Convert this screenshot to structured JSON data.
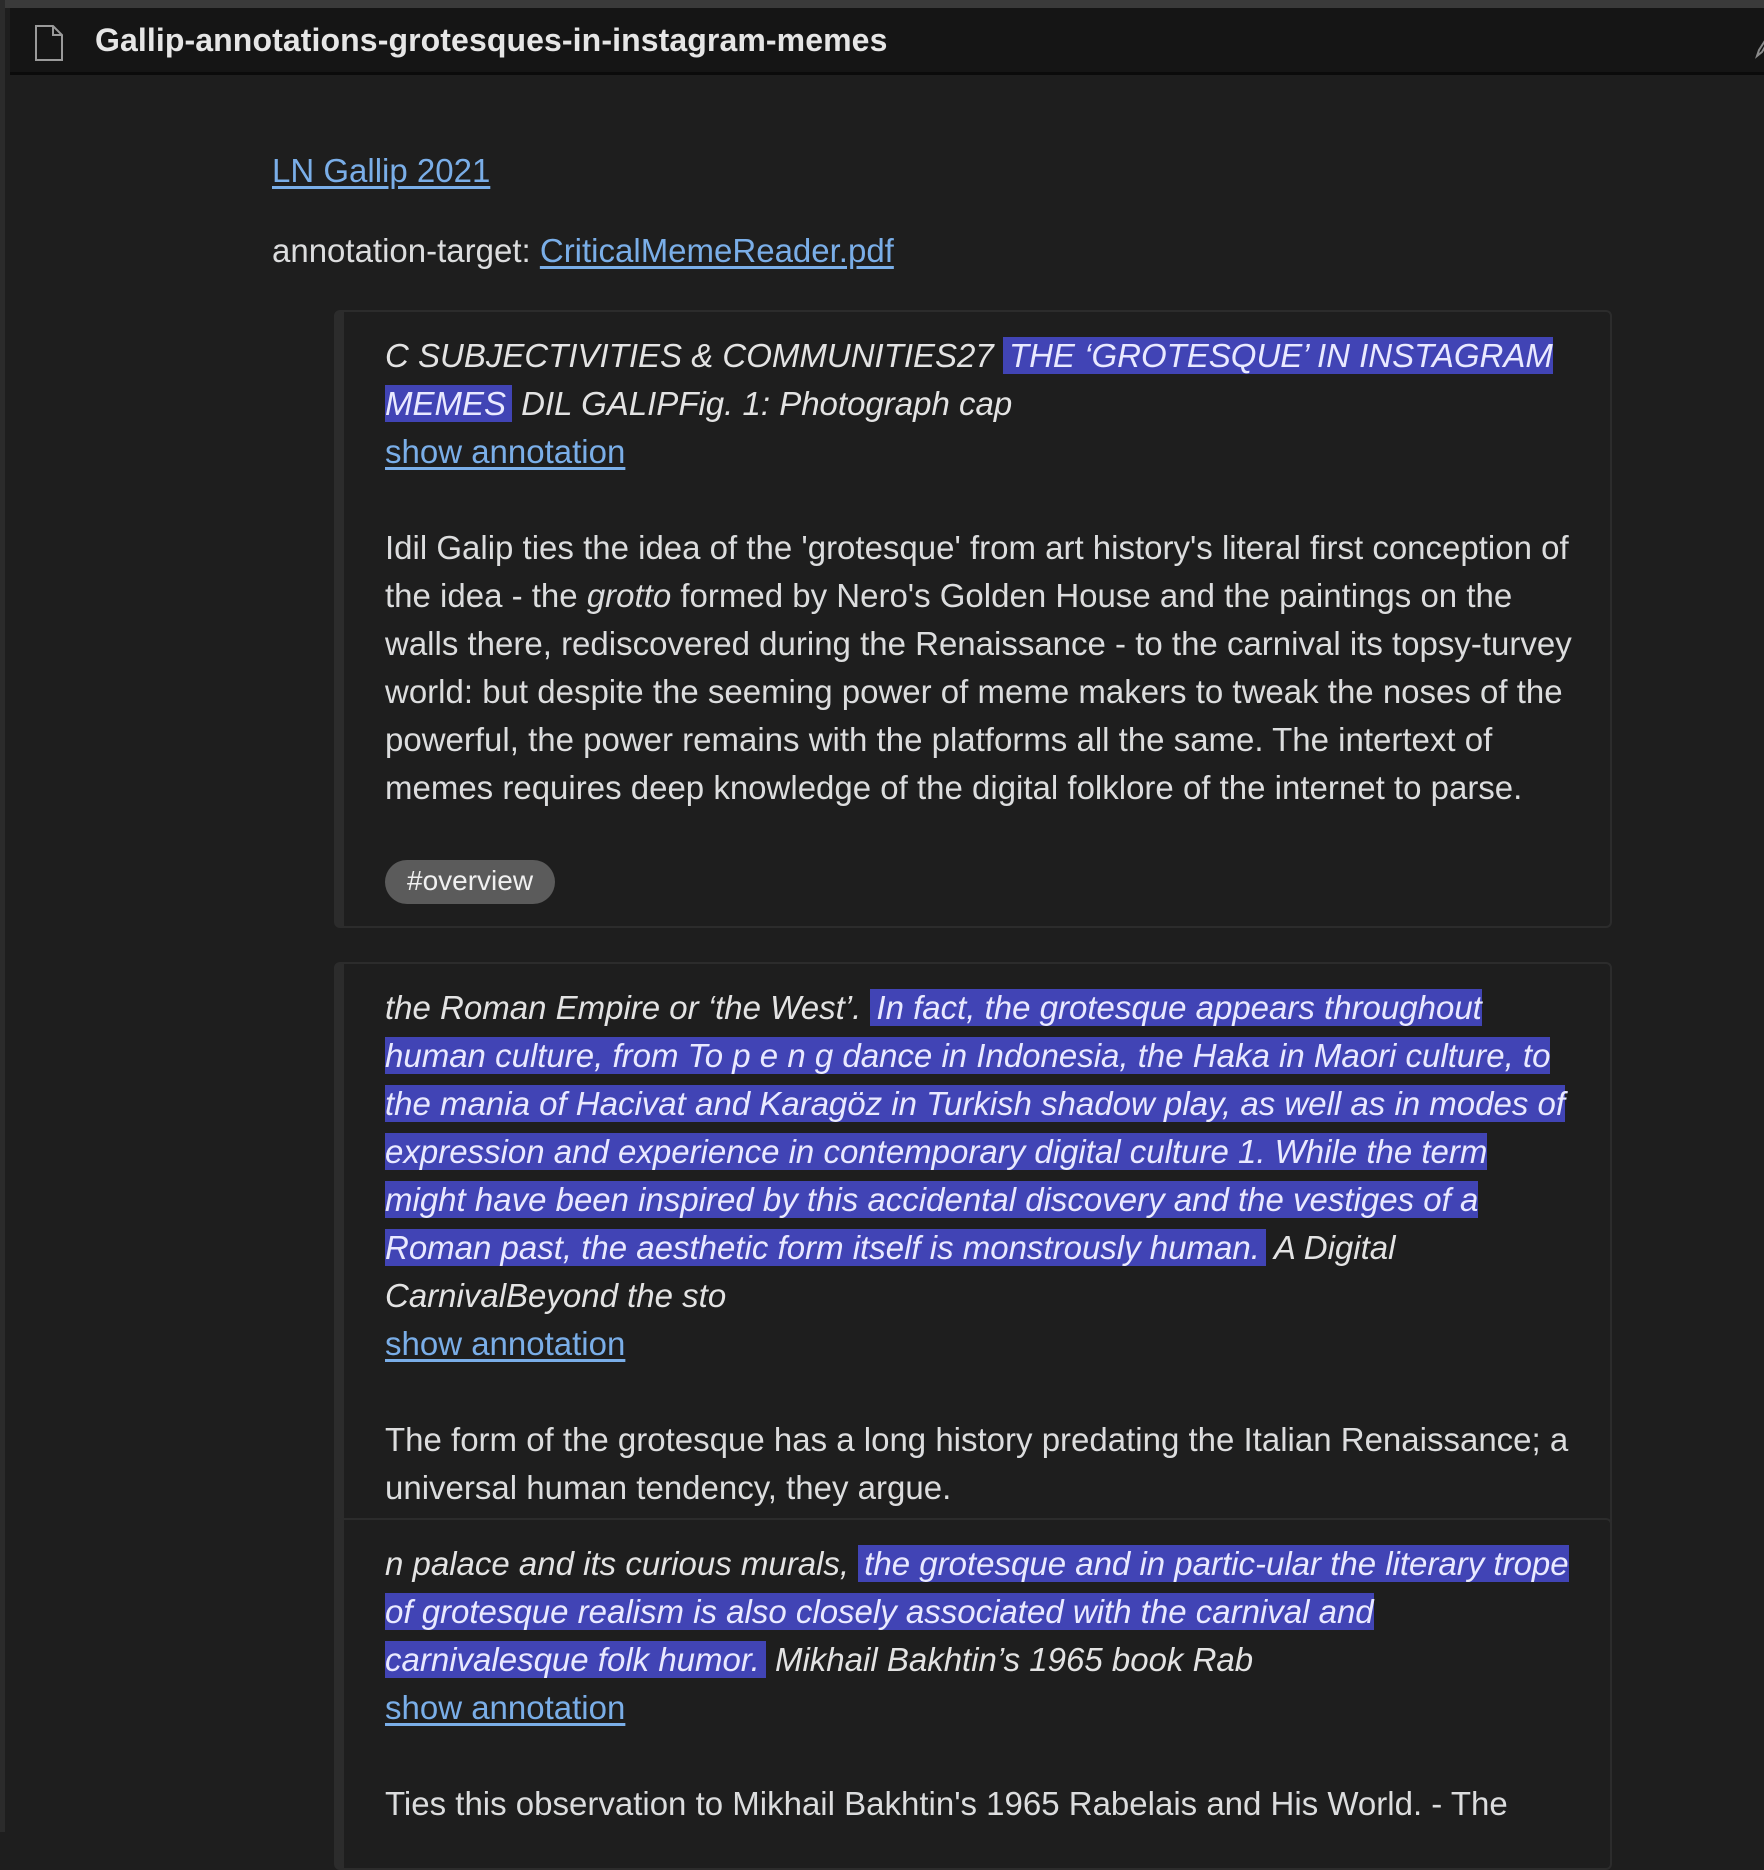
{
  "window": {
    "title": "Gallip-annotations-grotesques-in-instagram-memes",
    "icons": {
      "file": "file-icon",
      "edit": "edit-icon"
    }
  },
  "header": {
    "source_link": "LN Gallip 2021",
    "target_label": "annotation-target: ",
    "target_link": "CriticalMemeReader.pdf"
  },
  "annotations": [
    {
      "prefix": "C SUBJECTIVITIES & COMMUNITIES27 ",
      "highlight": "THE ‘GROTESQUE’ IN INSTAGRAM MEMES",
      "suffix": " DIL GALIPFig. 1: Photograph cap",
      "show_label": "show annotation",
      "note_before": "Idil Galip ties the idea of the 'grotesque' from art history's literal first conception of the idea - the ",
      "note_em": "grotto",
      "note_after": " formed by Nero's Golden House and the paintings on the walls there, rediscovered during the Renaissance - to the carnival its topsy-turvey world: but despite the seeming power of meme makers to tweak the noses of the powerful, the power remains with the platforms all the same. The intertext of memes requires deep knowledge of the digital folklore of the internet to parse.",
      "tag": "#overview"
    },
    {
      "prefix": "the Roman Empire or ‘the West’. ",
      "highlight": "In fact, the grotesque appears throughout human culture, from To p e n g dance in Indonesia, the Haka in Maori culture, to the mania of Hacivat and Karagöz in Turkish shadow play, as well as in modes of expression and experience in contemporary digital culture 1. While the term might have been inspired by this accidental discovery and the vestiges of a Roman past, the aesthetic form itself is monstrously human.",
      "suffix": " A Digital CarnivalBeyond the sto",
      "show_label": "show annotation",
      "note": "The form of the grotesque has a long history predating the Italian Renaissance; a universal human tendency, they argue."
    },
    {
      "prefix": "n palace and its curious murals, ",
      "highlight": "the grotesque and in partic-ular the literary trope of grotesque realism is also closely associated with the carnival and carnivalesque folk humor.",
      "suffix": " Mikhail Bakhtin’s 1965 book Rab",
      "show_label": "show annotation",
      "note": "Ties this observation to Mikhail Bakhtin's 1965 Rabelais and His World. - The"
    }
  ],
  "colors": {
    "background": "#1e1e1e",
    "titlebar": "#151515",
    "highlight": "#4144b5",
    "link": "#7aaee8",
    "tag_bg": "#5b5b5b"
  }
}
